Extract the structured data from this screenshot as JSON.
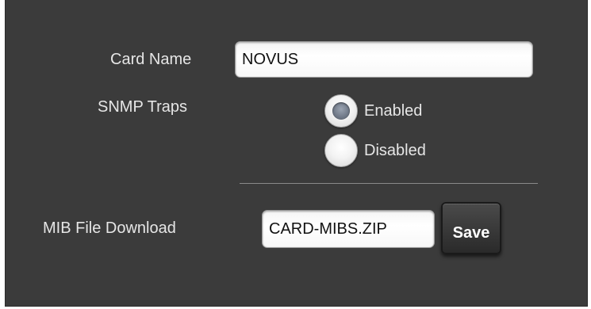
{
  "form": {
    "card_name_label": "Card Name",
    "card_name_value": "NOVUS",
    "snmp_traps_label": "SNMP Traps",
    "snmp_options": [
      {
        "label": "Enabled",
        "checked": true
      },
      {
        "label": "Disabled",
        "checked": false
      }
    ],
    "mib_label": "MIB File Download",
    "mib_value": "CARD-MIBS.ZIP",
    "save_label": "Save"
  }
}
